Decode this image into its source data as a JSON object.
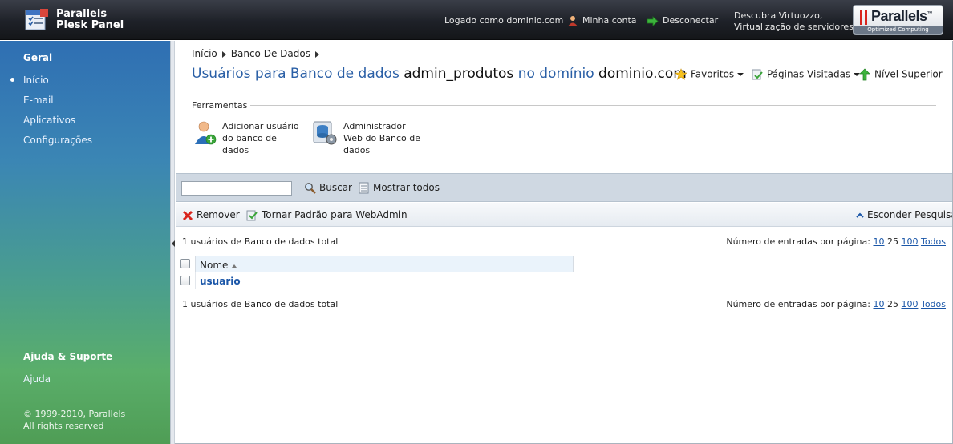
{
  "header": {
    "logo_line1": "Parallels",
    "logo_line2": "Plesk Panel",
    "logged_in": "Logado como dominio.com",
    "my_account": "Minha conta",
    "logout": "Desconectar",
    "promo_line1": "Descubra Virtuozzo,",
    "promo_line2": "Virtualização de servidores",
    "brand": "Parallels",
    "brand_tm": "™",
    "brand_tagline": "Optimized Computing"
  },
  "sidebar": {
    "section_general": "Geral",
    "items": [
      {
        "label": "Início",
        "active": true
      },
      {
        "label": "E-mail",
        "active": false
      },
      {
        "label": "Aplicativos",
        "active": false
      },
      {
        "label": "Configurações",
        "active": false
      }
    ],
    "section_help": "Ajuda & Suporte",
    "help_item": "Ajuda",
    "copyright_line1": "© 1999-2010, Parallels",
    "copyright_line2": "All rights reserved"
  },
  "main": {
    "breadcrumb": [
      "Início",
      "Banco De Dados"
    ],
    "title_part1": "Usuários para Banco de dados",
    "title_db": "admin_produtos",
    "title_part2": "no domínio",
    "title_domain": "dominio.com",
    "nav": {
      "favorites": "Favoritos",
      "visited": "Páginas Visitadas",
      "up_level": "Nível Superior"
    },
    "tools_label": "Ferramentas",
    "tools": [
      {
        "label": "Adicionar usuário do banco de dados",
        "icon": "add-user-icon"
      },
      {
        "label": "Administrador Web do Banco de dados",
        "icon": "database-admin-icon"
      }
    ],
    "search": {
      "value": "",
      "placeholder": "",
      "search_label": "Buscar",
      "show_all_label": "Mostrar todos"
    },
    "actions": {
      "remove": "Remover",
      "set_default": "Tornar Padrão para WebAdmin",
      "hide_search": "Esconder Pesquisa"
    },
    "total_text": "1 usuários de Banco de dados total",
    "per_page_label": "Número de entradas por página:",
    "per_page_options": [
      "10",
      "25",
      "100",
      "Todos"
    ],
    "table": {
      "column_name": "Nome",
      "rows": [
        {
          "name": "usuario"
        }
      ]
    }
  },
  "colors": {
    "header_bg": "#1e2128",
    "title_blue": "#2a5fa6",
    "link_blue": "#1a56a8",
    "searchbar_bg": "#cfd8e2"
  }
}
